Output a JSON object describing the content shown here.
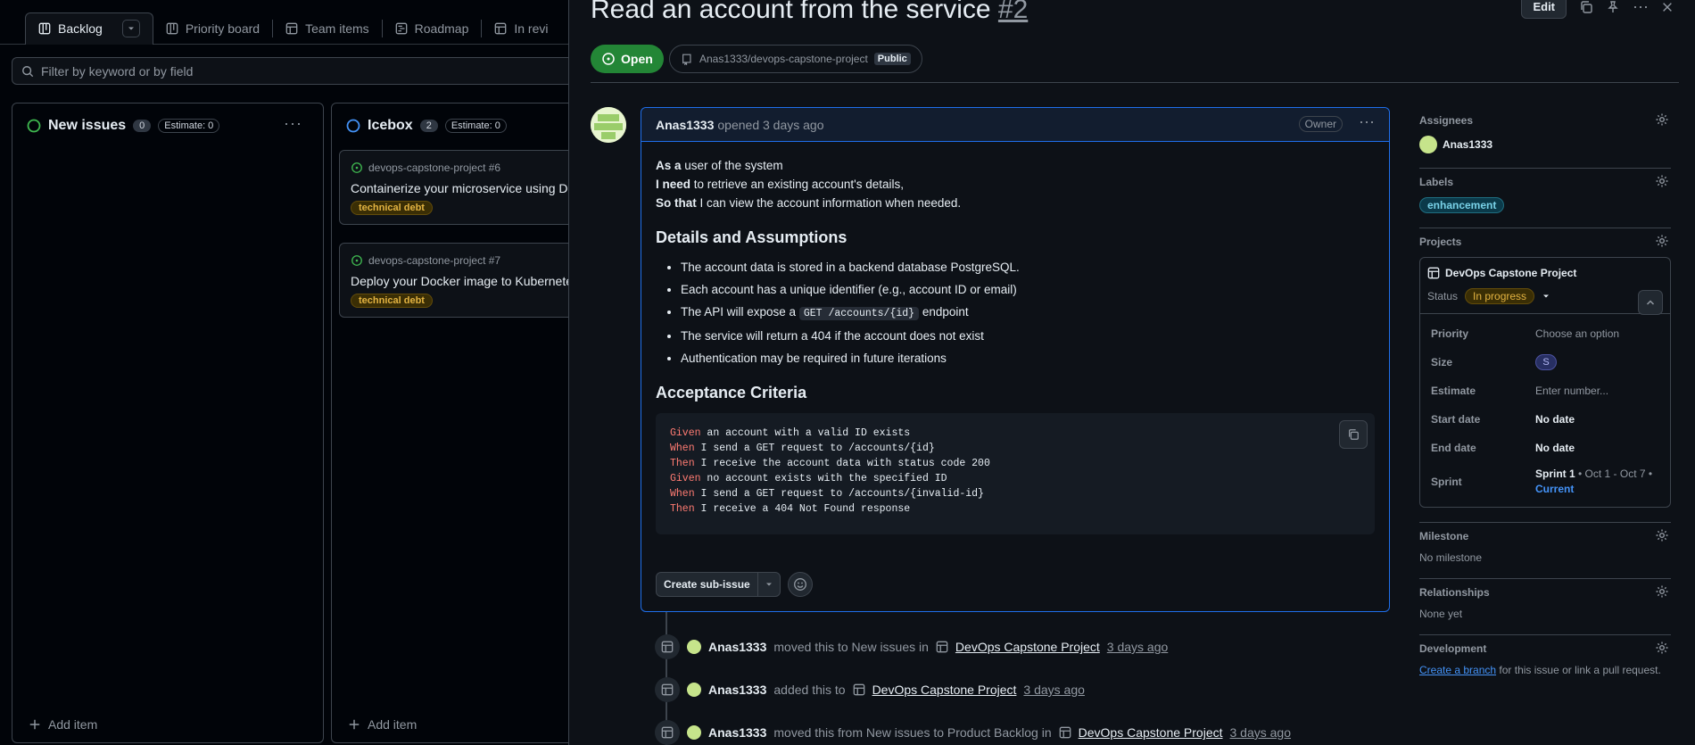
{
  "board": {
    "tabs": [
      "Backlog",
      "Priority board",
      "Team items",
      "Roadmap",
      "In revi"
    ],
    "filter_placeholder": "Filter by keyword or by field",
    "columns": [
      {
        "title": "New issues",
        "count": "0",
        "estimate": "Estimate: 0",
        "add_label": "Add item",
        "status_color": "#3fb950"
      },
      {
        "title": "Icebox",
        "count": "2",
        "estimate": "Estimate: 0",
        "add_label": "Add item",
        "status_color": "#4493f8"
      }
    ],
    "cards": [
      {
        "repo": "devops-capstone-project #6",
        "title": "Containerize your microservice using Do",
        "label": "technical debt"
      },
      {
        "repo": "devops-capstone-project #7",
        "title": "Deploy your Docker image to Kubernetes",
        "label": "technical debt"
      }
    ]
  },
  "issue": {
    "title": "Read an account from the service",
    "number": "#2",
    "edit_label": "Edit",
    "state": "Open",
    "repo": "Anas1333/devops-capstone-project",
    "visibility": "Public",
    "author": "Anas1333",
    "opened": "opened 3 days ago",
    "owner_badge": "Owner",
    "story": [
      {
        "bold": "As a",
        "rest": " user of the system"
      },
      {
        "bold": "I need",
        "rest": " to retrieve an existing account's details,"
      },
      {
        "bold": "So that",
        "rest": " I can view the account information when needed."
      }
    ],
    "details_heading": "Details and Assumptions",
    "bullets": [
      "The account data is stored in a backend database PostgreSQL.",
      "Each account has a unique identifier (e.g., account ID or email)",
      "The API will expose a",
      "The service will return a 404 if the account does not exist",
      "Authentication may be required in future iterations"
    ],
    "endpoint_code": "GET /accounts/{id}",
    "endpoint_suffix": "endpoint",
    "acceptance_heading": "Acceptance Criteria",
    "code_lines": [
      {
        "kw": "Given",
        "rest": " an account with a valid ID exists"
      },
      {
        "kw": "When",
        "rest": " I send a GET request to /accounts/{id}"
      },
      {
        "kw": "Then",
        "rest": " I receive the account data with status code 200"
      },
      {
        "kw": "Given",
        "rest": " no account exists with the specified ID"
      },
      {
        "kw": "When",
        "rest": " I send a GET request to /accounts/{invalid-id}"
      },
      {
        "kw": "Then",
        "rest": " I receive a 404 Not Found response"
      }
    ],
    "create_sub_issue": "Create sub-issue"
  },
  "timeline": [
    {
      "who": "Anas1333",
      "text": "moved this to New issues in",
      "project": "DevOps Capstone Project",
      "when": "3 days ago"
    },
    {
      "who": "Anas1333",
      "text": "added this to",
      "project": "DevOps Capstone Project",
      "when": "3 days ago"
    },
    {
      "who": "Anas1333",
      "text": "moved this from New issues to Product Backlog in",
      "project": "DevOps Capstone Project",
      "when": "3 days ago"
    }
  ],
  "sidebar": {
    "assignees_h": "Assignees",
    "assignee": "Anas1333",
    "labels_h": "Labels",
    "label": "enhancement",
    "projects_h": "Projects",
    "project_name": "DevOps Capstone Project",
    "status_k": "Status",
    "status_v": "In progress",
    "fields": {
      "priority_k": "Priority",
      "priority_v": "Choose an option",
      "size_k": "Size",
      "size_v": "S",
      "estimate_k": "Estimate",
      "estimate_v": "Enter number...",
      "start_k": "Start date",
      "start_v": "No date",
      "end_k": "End date",
      "end_v": "No date",
      "sprint_k": "Sprint",
      "sprint_v": "Sprint 1",
      "sprint_range": " • Oct 1 - Oct 7 •",
      "sprint_current": "Current"
    },
    "milestone_h": "Milestone",
    "milestone_v": "No milestone",
    "relationships_h": "Relationships",
    "relationships_v": "None yet",
    "development_h": "Development",
    "dev_link": "Create a branch",
    "dev_rest": " for this issue or link a pull request."
  }
}
